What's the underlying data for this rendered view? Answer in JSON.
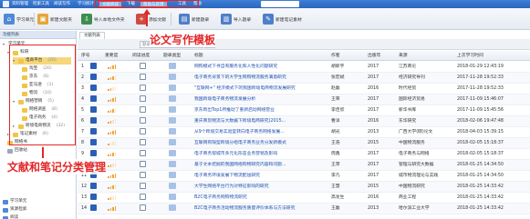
{
  "menubar": {
    "items": [
      "资料管理",
      "检索工具",
      "阅读写作",
      "学习统计",
      "文献阅读",
      "下载",
      "帮助与反馈",
      "工具",
      "帮助"
    ],
    "active_index": 5
  },
  "toolbar": {
    "buttons": [
      {
        "label": "学习单元",
        "icon": "home-icon",
        "color": "#4f8ad6"
      },
      {
        "label": "新建文献夹",
        "icon": "new-folder-icon",
        "color": "#e6a53b"
      },
      {
        "label": "导入本地文件夹",
        "icon": "import-icon",
        "color": "#3d8e4f"
      },
      {
        "label": "添加文献",
        "icon": "add-icon",
        "color": "#d04b3f"
      },
      {
        "label": "新建题录",
        "icon": "new-record-icon",
        "color": "#4f7fc9"
      },
      {
        "label": "导入题录",
        "icon": "import-record-icon",
        "color": "#4f7fc9"
      },
      {
        "label": "新建笔记素材",
        "icon": "note-icon",
        "color": "#4f7fc9"
      }
    ],
    "annotation": "论文写作模板"
  },
  "sidebar": {
    "header": "功能列表",
    "tree": [
      {
        "label": "学习单元",
        "count": "",
        "level": 0,
        "selected": false
      },
      {
        "label": "科研",
        "count": "",
        "level": 1,
        "selected": false
      },
      {
        "label": "电商平台",
        "count": "(20)",
        "level": 2,
        "selected": true
      },
      {
        "label": "淘宝",
        "count": "(20)",
        "level": 3,
        "selected": false
      },
      {
        "label": "京东",
        "count": "(6)",
        "level": 3,
        "selected": false
      },
      {
        "label": "亚马逊",
        "count": "(1)",
        "level": 3,
        "selected": false
      },
      {
        "label": "物流",
        "count": "(10)",
        "level": 3,
        "selected": false
      },
      {
        "label": "网络营销",
        "count": "(5)",
        "level": 2,
        "selected": false
      },
      {
        "label": "网络调查",
        "count": "(8)",
        "level": 3,
        "selected": false
      },
      {
        "label": "电子商务",
        "count": "(4)",
        "level": 3,
        "selected": false
      },
      {
        "label": "跨境电商物流",
        "count": "(32)",
        "level": 2,
        "selected": false
      },
      {
        "label": "笔记素材",
        "count": "(6)",
        "level": 1,
        "selected": false
      },
      {
        "label": "网络书",
        "count": "",
        "level": 1,
        "selected": false
      },
      {
        "label": "回收站",
        "count": "",
        "level": 1,
        "selected": false
      }
    ],
    "bottom": [
      "学习单元",
      "资源检索",
      "阅读"
    ],
    "annotation": "文献和笔记分类管理"
  },
  "main": {
    "tab": "文献列表",
    "filter": {
      "placeholder": "题录检索",
      "button": "🔍"
    },
    "columns": [
      "序号",
      "重要度",
      "阅读进度",
      "题录类型",
      "标题",
      "作者",
      "出版年",
      "来源",
      "上次学习时间"
    ],
    "rows": [
      {
        "no": "1",
        "title": "网购模式下寻自有服务化和人性化问题研究",
        "author": "胡新宇",
        "year": "2017",
        "source": "江苏商论",
        "time": "2018-01-29 12:43:19"
      },
      {
        "no": "2",
        "title": "电子商务背景下的大学生网购物流服务满意研究",
        "author": "张宏斌",
        "year": "2017",
        "source": "经济研究导刊",
        "time": "2017-11-28 19:52:33"
      },
      {
        "no": "3",
        "title": "\"互联网+\" 经济模式下的我国跨境电商物流发展研究",
        "author": "赵磊",
        "year": "2016",
        "source": "时代经贸",
        "time": "2017-11-28 19:52:33"
      },
      {
        "no": "4",
        "title": "我国跨境电子商务物流发展分析",
        "author": "王荣",
        "year": "2017",
        "source": "国际经济贸易",
        "time": "2017-11-09 15:46:07"
      },
      {
        "no": "5",
        "title": "京东跨出Top1所推动了重新启动网络营业",
        "author": "李佳欣",
        "year": "2017",
        "source": "新华书库",
        "time": "2017-11-09 15:45:56"
      },
      {
        "no": "6",
        "title": "重庆商贸物流与大数据下跨境电商研究(2015...",
        "author": "曹洋",
        "year": "2016",
        "source": "东华研究",
        "time": "2018-02-06 19:47:48"
      },
      {
        "no": "7",
        "title": "从9个跨境交易实验室转向电子商务网络发展...",
        "author": "胡光",
        "year": "2013",
        "source": "广西大学(硕)论文",
        "time": "2018-04-03 15:39:15"
      },
      {
        "no": "8",
        "title": "互联网有限型跨境分组电子商务业务分发新模式",
        "author": "王浩",
        "year": "2015",
        "source": "中国物流服务",
        "time": "2018-02-05 15:18:37"
      },
      {
        "no": "9",
        "title": "电子商务帮城市多元化形态业务营销及影响",
        "author": "周鑫",
        "year": "2017",
        "source": "电子商务与网络",
        "time": "2018-02-05 15:18:37"
      },
      {
        "no": "10",
        "title": "基于文本挖掘的我国网络购物研究内容和问题...",
        "author": "王萍",
        "year": "2017",
        "source": "管理与研究大数据",
        "time": "2018-01-25 14:34:50"
      },
      {
        "no": "11",
        "title": "电子商务环境发展下物流配送研究",
        "author": "李凡",
        "year": "2017",
        "source": "城市物流理论与实践",
        "time": "2018-01-25 14:34:50"
      },
      {
        "no": "12",
        "title": "大学生网络平台行为对特征影响的研究",
        "author": "王慧",
        "year": "2015",
        "source": "中国物流研究",
        "time": "2018-01-25 14:33:42"
      },
      {
        "no": "13",
        "title": "B2C电子商务网购物流研究",
        "author": "高龙生",
        "year": "2016",
        "source": "商业工程",
        "time": "2018-01-25 14:33:42"
      },
      {
        "no": "14",
        "title": "B2C电子商务活动物流服务质量评价体系与方法研究",
        "author": "王磊",
        "year": "2013",
        "source": "哈尔滨工业大学",
        "time": "2018-01-25 14:33:42"
      }
    ]
  },
  "colors": {
    "accent": "#2b66bd",
    "annotation": "#e32727",
    "selected": "#f6d77b"
  }
}
